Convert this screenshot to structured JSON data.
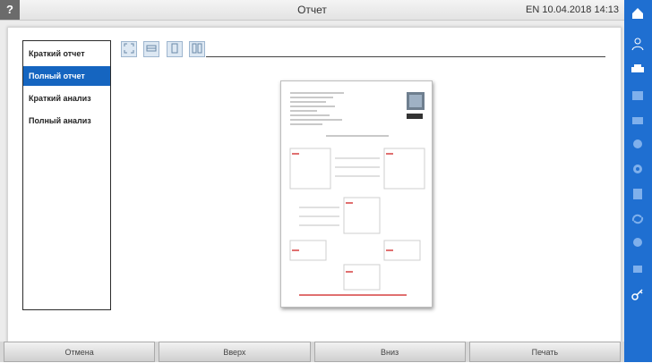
{
  "titlebar": {
    "help_label": "?",
    "title": "Отчет",
    "status": "EN 10.04.2018 14:13"
  },
  "menu": {
    "items": [
      {
        "label": "Краткий отчет"
      },
      {
        "label": "Полный отчет"
      },
      {
        "label": "Краткий анализ"
      },
      {
        "label": "Полный анализ"
      }
    ],
    "selected": "Полный отчет"
  },
  "toolbar": {
    "icons": [
      "zoom-fit-icon",
      "zoom-width-icon",
      "page-single-icon",
      "page-double-icon"
    ]
  },
  "footer": {
    "buttons": [
      {
        "label": "Отмена"
      },
      {
        "label": "Вверх"
      },
      {
        "label": "Вниз"
      },
      {
        "label": "Печать"
      }
    ]
  },
  "sidebar": {
    "icons": [
      "home-icon",
      "user-icon",
      "car-icon",
      "list-icon",
      "document-icon",
      "settings-icon",
      "gear-icon",
      "report-icon",
      "sync-icon",
      "globe-icon",
      "print-icon",
      "key-icon"
    ]
  },
  "colors": {
    "accent": "#1f6fd1",
    "selection": "#1565c0"
  }
}
